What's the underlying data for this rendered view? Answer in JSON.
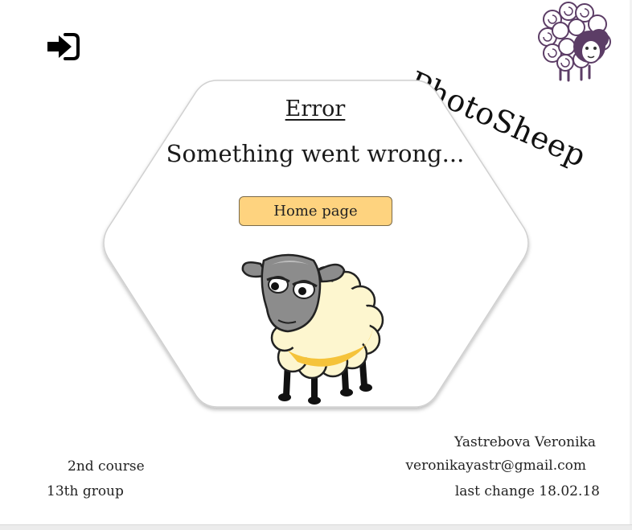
{
  "header": {
    "login_icon": "sign-in-icon",
    "brand_name": "PhotoSheep",
    "brand_logo": "curly-sheep-logo"
  },
  "error_panel": {
    "title": "Error",
    "message": "Something went wrong...",
    "home_button_label": "Home page",
    "illustration": "sad-sheep-illustration"
  },
  "footer": {
    "course": "2nd course",
    "group": "13th group",
    "author": "Yastrebova Veronika",
    "email": "veronikayastr@gmail.com",
    "last_change": "last change 18.02.18"
  },
  "colors": {
    "button_bg": "#fed37f",
    "sheep_wool": "#fdf6cf",
    "sheep_shadow": "#f5c33a",
    "sheep_face": "#8c8c8c",
    "logo_wool": "#5c3d66"
  }
}
